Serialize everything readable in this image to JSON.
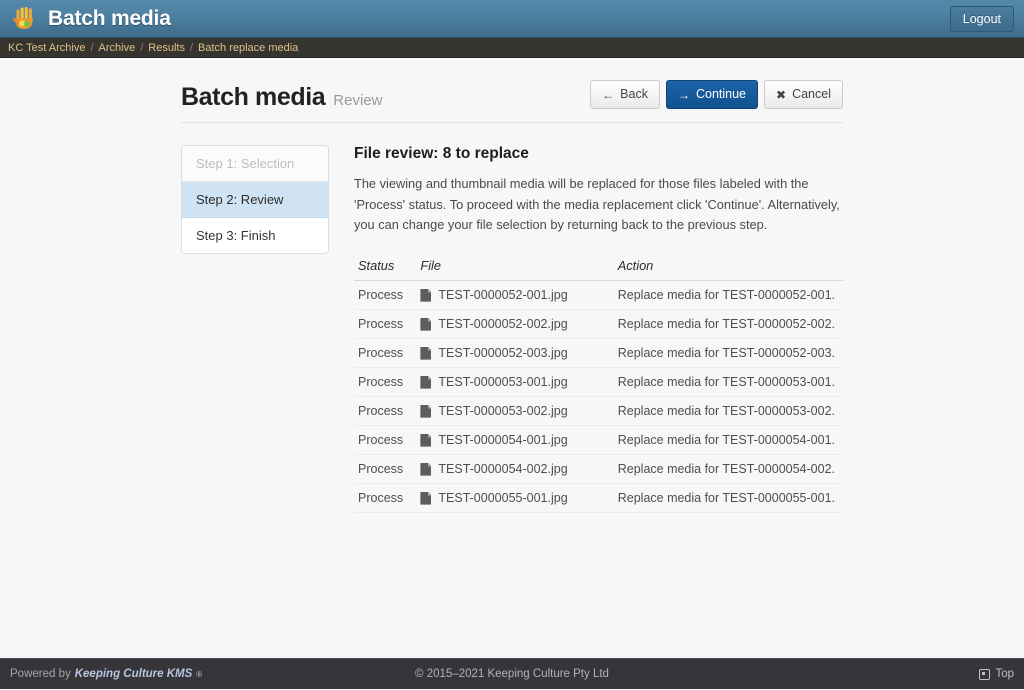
{
  "header": {
    "app_title": "Batch media",
    "logo_icon": "hand-logo-icon",
    "logout_label": "Logout"
  },
  "breadcrumb": {
    "separator": "/",
    "items": [
      {
        "label": "KC Test Archive"
      },
      {
        "label": "Archive"
      },
      {
        "label": "Results"
      },
      {
        "label": "Batch replace media"
      }
    ]
  },
  "page": {
    "title": "Batch media",
    "subtitle": "Review"
  },
  "toolbar": {
    "buttons": [
      {
        "label": "Back",
        "icon": "arrow-left-icon",
        "glyph": "←",
        "style": "default"
      },
      {
        "label": "Continue",
        "icon": "arrow-right-icon",
        "glyph": "→",
        "style": "primary"
      },
      {
        "label": "Cancel",
        "icon": "close-x-icon",
        "glyph": "✖",
        "style": "default"
      }
    ]
  },
  "steps": [
    {
      "label": "Step 1: Selection",
      "state": "disabled"
    },
    {
      "label": "Step 2: Review",
      "state": "active"
    },
    {
      "label": "Step 3: Finish",
      "state": "default"
    }
  ],
  "review": {
    "heading": "File review: 8 to replace",
    "description": "The viewing and thumbnail media will be replaced for those files labeled with the 'Process' status. To proceed with the media replacement click 'Continue'. Alternatively, you can change your file selection by returning back to the previous step."
  },
  "table": {
    "columns": [
      "Status",
      "File",
      "Action"
    ],
    "rows": [
      {
        "status": "Process",
        "file": "TEST-0000052-001.jpg",
        "action": "Replace media for TEST-0000052-001."
      },
      {
        "status": "Process",
        "file": "TEST-0000052-002.jpg",
        "action": "Replace media for TEST-0000052-002."
      },
      {
        "status": "Process",
        "file": "TEST-0000052-003.jpg",
        "action": "Replace media for TEST-0000052-003."
      },
      {
        "status": "Process",
        "file": "TEST-0000053-001.jpg",
        "action": "Replace media for TEST-0000053-001."
      },
      {
        "status": "Process",
        "file": "TEST-0000053-002.jpg",
        "action": "Replace media for TEST-0000053-002."
      },
      {
        "status": "Process",
        "file": "TEST-0000054-001.jpg",
        "action": "Replace media for TEST-0000054-001."
      },
      {
        "status": "Process",
        "file": "TEST-0000054-002.jpg",
        "action": "Replace media for TEST-0000054-002."
      },
      {
        "status": "Process",
        "file": "TEST-0000055-001.jpg",
        "action": "Replace media for TEST-0000055-001."
      }
    ]
  },
  "footer": {
    "powered_by": "Powered by",
    "product": "Keeping Culture KMS",
    "registered_mark": "®",
    "copyright": "© 2015–2021 Keeping Culture Pty Ltd",
    "top_label": "Top",
    "top_icon": "scroll-to-top-icon"
  },
  "colors": {
    "header_blue": "#4e81a2",
    "primary_button": "#11528f",
    "breadcrumb_link": "#e0c08a",
    "active_step": "#cfe3f2",
    "footer_bg": "#36353a",
    "product_accent": "#b6c4e0"
  }
}
